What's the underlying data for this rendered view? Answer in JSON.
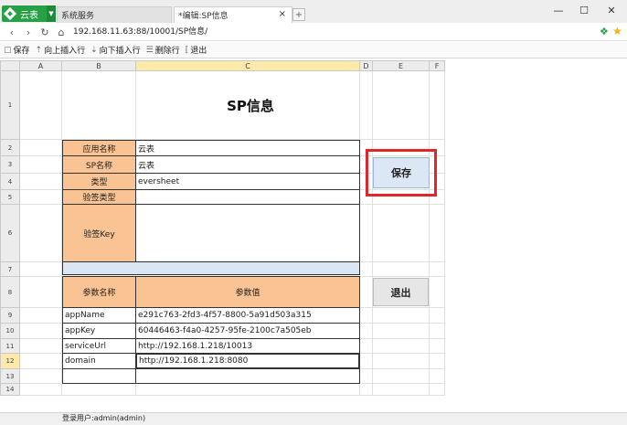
{
  "app": {
    "name": "云表",
    "logo_icon": "diamond-logo-icon"
  },
  "tabs": [
    {
      "label": "系统服务"
    },
    {
      "label": "*编辑:SP信息"
    }
  ],
  "address": {
    "url": "192.168.11.63:88/10001/SP信息/"
  },
  "toolbar": {
    "save": "保存",
    "insert_above": "向上插入行",
    "insert_below": "向下插入行",
    "delete_row": "删除行",
    "exit": "退出"
  },
  "sheet": {
    "columns": [
      "A",
      "B",
      "C",
      "D",
      "E",
      "F"
    ],
    "rows": [
      "1",
      "2",
      "3",
      "4",
      "5",
      "6",
      "7",
      "8",
      "9",
      "10",
      "11",
      "12",
      "13",
      "14"
    ],
    "active_column": "C",
    "active_row": "12",
    "title": "SP信息",
    "fields": [
      {
        "label": "应用名称",
        "value": "云表"
      },
      {
        "label": "SP名称",
        "value": "云表"
      },
      {
        "label": "类型",
        "value": "eversheet"
      },
      {
        "label": "验签类型",
        "value": ""
      },
      {
        "label": "验签Key",
        "value": ""
      }
    ],
    "param_header": {
      "name": "参数名称",
      "value": "参数值"
    },
    "params": [
      {
        "name": "appName",
        "value": "e291c763-2fd3-4f57-8800-5a91d503a315"
      },
      {
        "name": "appKey",
        "value": "60446463-f4a0-4257-95fe-2100c7a505eb"
      },
      {
        "name": "serviceUrl",
        "value": "http://192.168.1.218/10013"
      },
      {
        "name": "domain",
        "value": "http://192.168.1.218:8080"
      },
      {
        "name": "",
        "value": ""
      }
    ]
  },
  "buttons": {
    "save": "保存",
    "exit": "退出"
  },
  "status": {
    "user": "登录用户:admin(admin)"
  },
  "colors": {
    "label_fill": "#f9c393",
    "separator_fill": "#dae6f3",
    "highlight": "#e0262a",
    "accent": "#27a046"
  }
}
